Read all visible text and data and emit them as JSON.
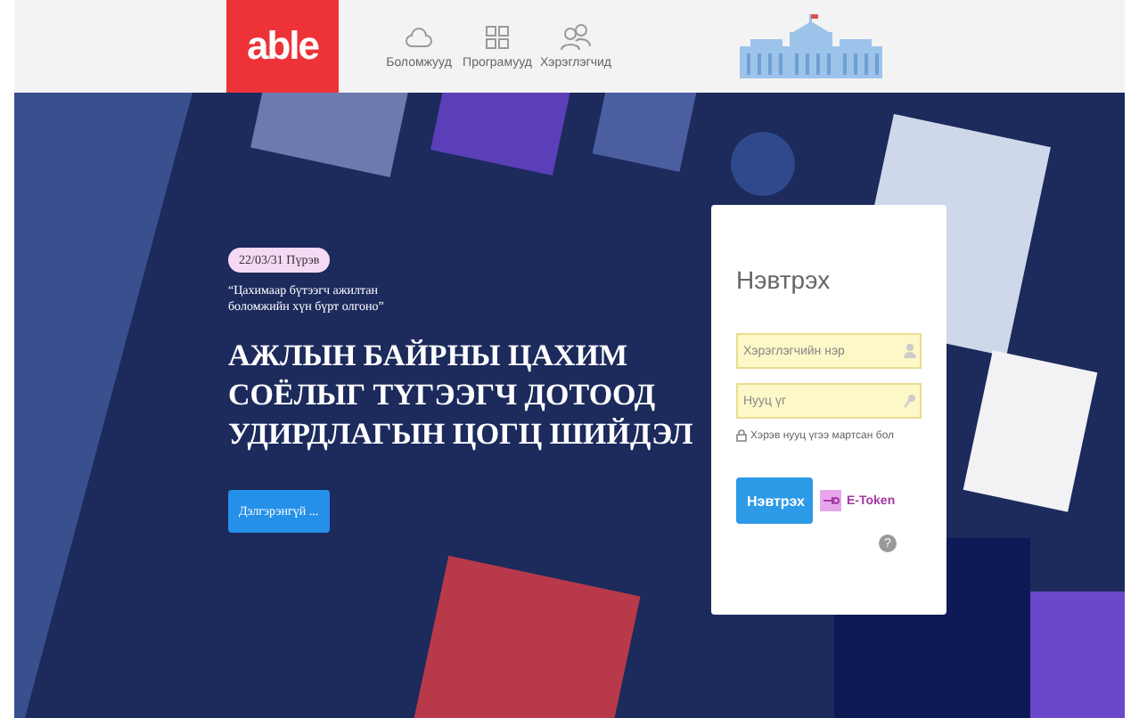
{
  "header": {
    "logo": "able",
    "nav": [
      {
        "label": "Боломжууд"
      },
      {
        "label": "Програмууд"
      },
      {
        "label": "Хэрэглэгчид"
      }
    ]
  },
  "hero": {
    "badge": "22/03/31 Пүрэв",
    "quote": "“Цахимаар бүтээгч ажилтан боломжийн хүн бүрт олгоно”",
    "headline": [
      "АЖЛЫН БАЙРНЫ ЦАХИМ",
      "СОЁЛЫГ ТҮГЭЭГЧ ДОТООД",
      "УДИРДЛАГЫН ЦОГЦ ШИЙДЭЛ"
    ],
    "more_button": "Дэлгэрэнгүй ..."
  },
  "login": {
    "title": "Нэвтрэх",
    "fields": [
      {
        "placeholder": "Хэрэглэгчийн нэр",
        "kind": "user"
      },
      {
        "placeholder": "Нууц үг",
        "kind": "key"
      }
    ],
    "forgot": "Хэрэв нууц үгээ мартсан бол",
    "submit": "Нэвтрэх",
    "etoken": "E-Token",
    "help": "?"
  }
}
